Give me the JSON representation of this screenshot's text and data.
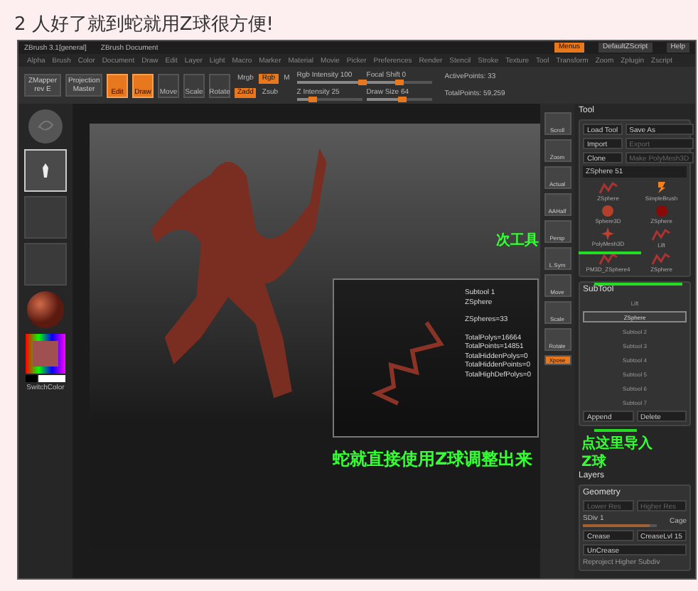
{
  "heading": "2 人好了就到蛇就用Z球很方便!",
  "titlebar": {
    "items": [
      "ZBrush 3.1[general]",
      "ZBrush Document"
    ],
    "buttons": [
      {
        "label": "Menus",
        "selected": true
      },
      {
        "label": "DefaultZScript",
        "selected": false
      },
      {
        "label": "Help",
        "selected": false
      }
    ]
  },
  "menu": [
    "Alpha",
    "Brush",
    "Color",
    "Document",
    "Draw",
    "Edit",
    "Layer",
    "Light",
    "Macro",
    "Marker",
    "Material",
    "Movie",
    "Picker",
    "Preferences",
    "Render",
    "Stencil",
    "Stroke",
    "Texture",
    "Tool",
    "Transform",
    "Zoom",
    "Zplugin",
    "Zscript"
  ],
  "toolbar": {
    "plugins": [
      "ZMapper rev E",
      "Projection Master"
    ],
    "modes": [
      {
        "label": "Edit",
        "selected": true
      },
      {
        "label": "Draw",
        "selected": true
      },
      {
        "label": "Move",
        "selected": false
      },
      {
        "label": "Scale",
        "selected": false
      },
      {
        "label": "Rotate",
        "selected": false
      }
    ],
    "color_modes": [
      {
        "label": "Mrgb",
        "selected": false
      },
      {
        "label": "Rgb",
        "selected": true
      },
      {
        "label": "M",
        "selected": false
      }
    ],
    "z_modes": [
      {
        "label": "Zadd",
        "selected": true
      },
      {
        "label": "Zsub",
        "selected": false
      }
    ],
    "sliders": [
      {
        "label": "Rgb Intensity 100",
        "level": 1
      },
      {
        "label": "Z Intensity 25",
        "level": 0.25
      },
      {
        "label": "Focal Shift 0",
        "level": 0.5
      },
      {
        "label": "Draw Size 64",
        "level": 0.55
      }
    ],
    "stats": [
      "ActivePoints: 33",
      "TotalPoints: 59,259"
    ]
  },
  "shelf": [
    {
      "kind": "brush"
    },
    {
      "kind": "stroke"
    },
    {
      "kind": "empty"
    },
    {
      "kind": "empty"
    },
    {
      "kind": "material"
    },
    {
      "kind": "color",
      "label": "SwitchColor"
    }
  ],
  "canvas_icons": [
    {
      "label": "Scroll",
      "selected": false
    },
    {
      "label": "Zoom",
      "selected": false
    },
    {
      "label": "Actual",
      "selected": false
    },
    {
      "label": "AAHalf",
      "selected": false
    },
    {
      "label": "Persp",
      "selected": false
    },
    {
      "label": "L.Sym",
      "selected": false
    },
    {
      "label": "Move",
      "selected": false
    },
    {
      "label": "Scale",
      "selected": false
    },
    {
      "label": "Rotate",
      "selected": false
    },
    {
      "label": "Xpose",
      "selected": true
    }
  ],
  "info": [
    [
      "Subtool 1",
      "ZSphere"
    ],
    [
      "ZSpheres=33"
    ],
    [
      "TotalPolys=16664",
      "TotalPoints=14851",
      "TotalHiddenPolys=0",
      "TotalHiddenPoints=0",
      "TotalHighDefPolys=0"
    ]
  ],
  "tool": {
    "title": "Tool",
    "buttons": [
      {
        "label": "Load Tool",
        "disabled": false
      },
      {
        "label": "Save As",
        "disabled": false
      },
      {
        "label": "Import",
        "disabled": false
      },
      {
        "label": "Export",
        "disabled": true
      },
      {
        "label": "Clone",
        "disabled": false
      },
      {
        "label": "Make PolyMesh3D",
        "disabled": true
      }
    ],
    "current": "ZSphere 51",
    "thumbs": [
      {
        "label": "ZSphere",
        "kind": "chain"
      },
      {
        "label": "SimpleBrush",
        "kind": "brush"
      },
      {
        "label": "Sphere3D",
        "kind": "sphere"
      },
      {
        "label": "ZSphere",
        "kind": "ball"
      },
      {
        "label": "PolyMesh3D",
        "kind": "star"
      },
      {
        "label": "Lift",
        "kind": "chain"
      },
      {
        "label": "PM3D_ZSphere4",
        "kind": "chain"
      },
      {
        "label": "ZSphere",
        "kind": "chain"
      }
    ]
  },
  "subtool": {
    "title": "SubTool",
    "items": [
      {
        "label": "Lift",
        "selected": false
      },
      {
        "label": "ZSphere",
        "selected": true
      },
      {
        "label": "Subtool 2",
        "selected": false
      },
      {
        "label": "Subtool 3",
        "selected": false
      },
      {
        "label": "Subtool 4",
        "selected": false
      },
      {
        "label": "Subtool 5",
        "selected": false
      },
      {
        "label": "Subtool 6",
        "selected": false
      },
      {
        "label": "Subtool 7",
        "selected": false
      }
    ],
    "buttons": [
      "Append",
      "Delete"
    ]
  },
  "layers": {
    "title": "Layers"
  },
  "geometry": {
    "title": "Geometry",
    "buttons": [
      {
        "label": "Lower Res",
        "disabled": true
      },
      {
        "label": "Higher Res",
        "disabled": true
      }
    ],
    "sliders": [
      {
        "label": "SDiv 1",
        "level": 0.9
      }
    ],
    "cage": "Cage",
    "crease": [
      "Crease",
      "CreaseLvl 15",
      "UnCrease"
    ],
    "reproject": "Reproject Higher Subdiv"
  },
  "annotations": {
    "subtool": "次工具",
    "snake": "蛇就直接使用Z球调整出来",
    "import": "点这里导入",
    "zsphere": "Z球"
  }
}
